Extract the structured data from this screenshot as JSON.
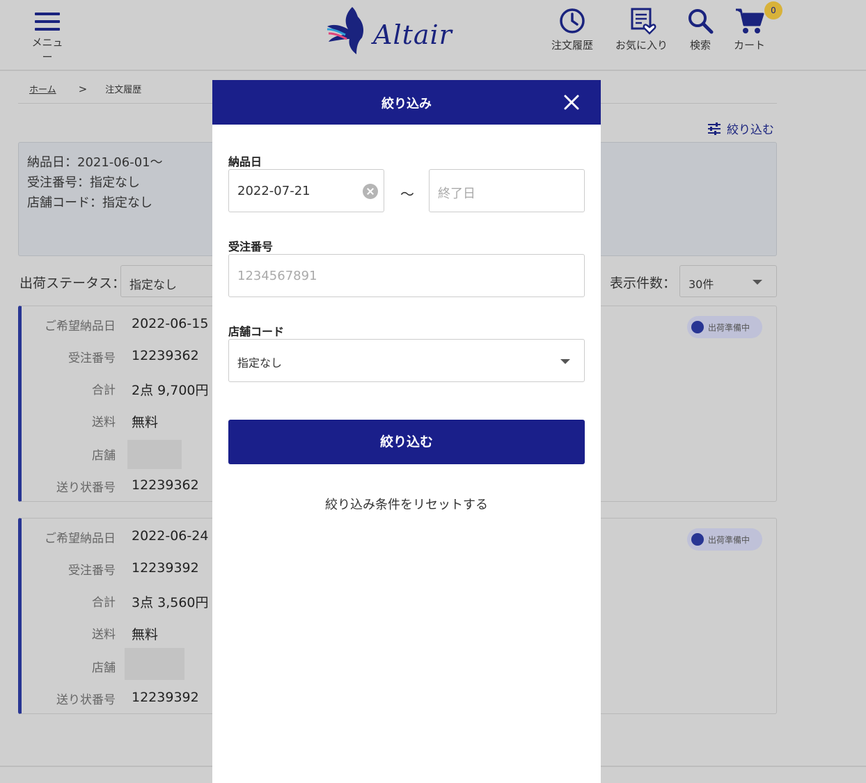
{
  "header": {
    "menu_label": "メニュー",
    "logo_text": "Altair",
    "nav": [
      {
        "label": "注文履歴",
        "icon": "clock-icon"
      },
      {
        "label": "お気に入り",
        "icon": "favorite-list-icon"
      },
      {
        "label": "検索",
        "icon": "search-icon"
      },
      {
        "label": "カート",
        "icon": "cart-icon"
      }
    ],
    "cart_count": "0"
  },
  "breadcrumb": {
    "home": "ホーム",
    "separator": ">",
    "current": "注文履歴"
  },
  "filter_link": "絞り込む",
  "conditions": [
    "納品日：2021-06-01～",
    "受注番号：指定なし",
    "店舗コード：指定なし"
  ],
  "status_filter": {
    "label": "出荷ステータス：",
    "value": "指定なし"
  },
  "count_filter": {
    "label": "表示件数：",
    "value": "30件"
  },
  "orders": [
    {
      "rows": [
        {
          "key": "ご希望納品日",
          "value": "2022-06-15"
        },
        {
          "key": "受注番号",
          "value": "12239362"
        },
        {
          "key": "合計",
          "value": "2点 9,700円"
        },
        {
          "key": "送料",
          "value": "無料"
        },
        {
          "key": "店舗",
          "value": ""
        },
        {
          "key": "送り状番号",
          "value": "12239362"
        }
      ],
      "status": "出荷準備中"
    },
    {
      "rows": [
        {
          "key": "ご希望納品日",
          "value": "2022-06-24"
        },
        {
          "key": "受注番号",
          "value": "12239392"
        },
        {
          "key": "合計",
          "value": "3点 3,560円"
        },
        {
          "key": "送料",
          "value": "無料"
        },
        {
          "key": "店舗",
          "value": ""
        },
        {
          "key": "送り状番号",
          "value": "12239392"
        }
      ],
      "status": "出荷準備中"
    }
  ],
  "modal": {
    "title": "絞り込み",
    "delivery_label": "納品日",
    "start_date": "2022-07-21",
    "range_sep": "～",
    "end_placeholder": "終了日",
    "order_no_label": "受注番号",
    "order_no_placeholder": "1234567891",
    "store_label": "店舗コード",
    "store_value": "指定なし",
    "submit": "絞り込む",
    "reset": "絞り込み条件をリセットする"
  },
  "colors": {
    "primary": "#1a1f8a",
    "accent_gold": "#d8b23a",
    "overlay_bg": "#cfcfcf"
  }
}
